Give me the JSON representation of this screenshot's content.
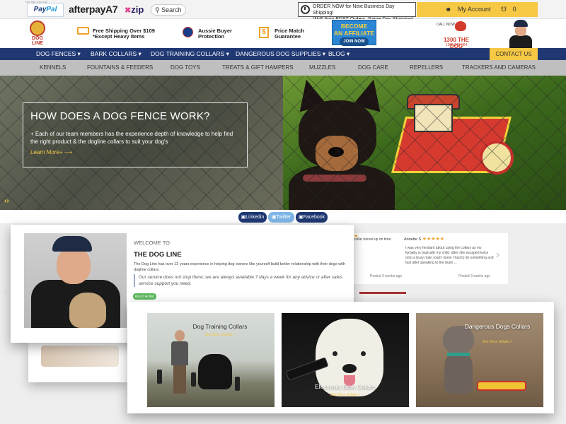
{
  "topbar": {
    "paypal_tagline": "Pay flag ship with",
    "paypal_1": "Pay",
    "paypal_2": "Pal",
    "afterpay": "afterpay",
    "afterpay_mark": "A7",
    "zip": "zip",
    "search_label": "Search",
    "order_notice_line1": "ORDER NOW for Next Business Day Shipping!",
    "order_notice_line2": "(M-F 6pm EDST Orders, Same Day Shipping)",
    "account_label": "My Account",
    "cart_label": "0 Cart"
  },
  "header": {
    "logo_text_1": "DOG",
    "logo_text_2": "LINE",
    "features": [
      {
        "line1": "Free Shipping Over $109",
        "line2": "*Except Heavy Items"
      },
      {
        "line1": "Aussie Buyer",
        "line2": "Protection"
      },
      {
        "line1": "Price Match",
        "line2": "Guarantee"
      }
    ],
    "affiliate_line1": "BECOME",
    "affiliate_line2": "AN AFFILIATE",
    "affiliate_join": "JOIN NOW",
    "call_now": "CALL NOW",
    "phone_1": "1300 THE DOG",
    "phone_2": "1300 843 364"
  },
  "main_nav": {
    "items": [
      "DOG FENCES ▾",
      "BARK COLLARS ▾",
      "DOG TRAINING COLLARS ▾",
      "DANGEROUS DOG SUPPLIES ▾",
      "BLOG ▾"
    ],
    "contact": "CONTACT US"
  },
  "sub_nav": {
    "items": [
      "KENNELS",
      "FOUNTAINS & FEEDERS",
      "DOG TOYS",
      "TREATS & GIFT HAMPERS",
      "MUZZLES",
      "DOG CARE",
      "REPELLERS",
      "TRACKERS AND CAMERAS"
    ]
  },
  "hero": {
    "title": "HOW DOES A DOG FENCE WORK?",
    "text": "+ Each of our team members has the experience depth of knowledge to help find the right product & the dogline collars to suit your dog's",
    "learn_more": "Learn More+ ⟶",
    "arrows": "‹›"
  },
  "social": {
    "linkedin": "Linkedin",
    "twitter": "Twitter",
    "facebook": "Facebook"
  },
  "welcome": {
    "label": "WELCOME TO",
    "title": "THE DOG LINE",
    "paragraph": "The Dog Line has over 12 years experience in helping dog owners like yourself build better relationship with their dogs with dogline collars.",
    "quote": "Our service does not stop there; we are always available 7 days a week for any advice or after sales service support you need.",
    "read_more": "READ MORE"
  },
  "reviews": {
    "partial_text": "collar turned up on time.",
    "partial_posted": "Posted 3 weeks ago",
    "reviewer": "Annette S",
    "stars": "★★★★★",
    "review_text": "I was very hesitant about using the collars as my furbaby is basically my child. after she escaped twice onto a busy main road I knew I had to do something and fast after speaking to the team ...",
    "posted": "Posted 3 weeks ago",
    "next_arrow": "›"
  },
  "categories": [
    {
      "title": "Dog Training Collars",
      "link": "See More Details >"
    },
    {
      "title": "Electronic Bark Collars",
      "link": "See More Details >"
    },
    {
      "title": "Dangerous Dogs Collars",
      "link": "See More Details >"
    }
  ],
  "colors": {
    "nav_blue": "#1f3873",
    "accent_yellow": "#f6c844",
    "subnav_grey": "#bfbfbf"
  }
}
